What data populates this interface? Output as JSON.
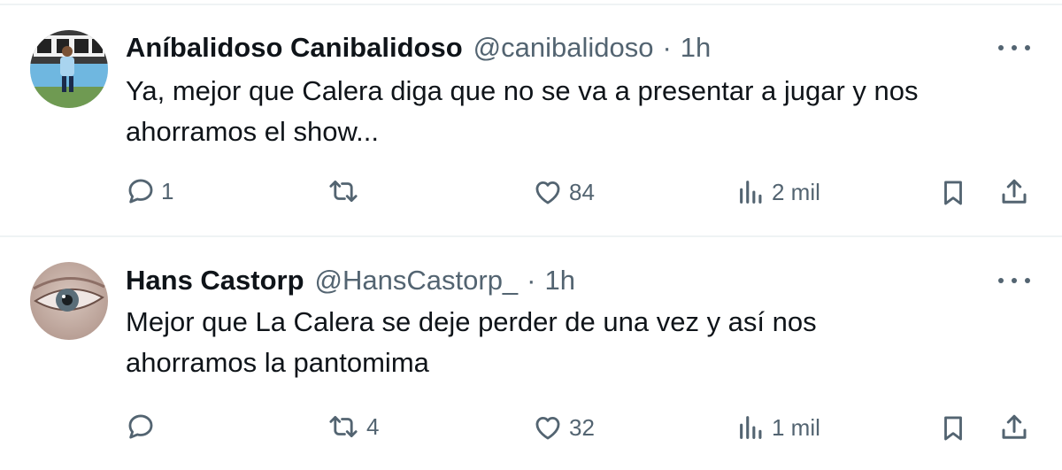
{
  "tweets": [
    {
      "display_name": "Aníbalidoso Canibalidoso",
      "handle": "@canibalidoso",
      "separator": "·",
      "time": "1h",
      "text": "Ya, mejor que Calera diga que no se va a presentar a jugar y nos ahorramos el show...",
      "replies": "1",
      "retweets": "",
      "likes": "84",
      "views": "2 mil"
    },
    {
      "display_name": "Hans Castorp",
      "handle": "@HansCastorp_",
      "separator": "·",
      "time": "1h",
      "text": "Mejor que La Calera se deje perder de una vez y así nos ahorramos la pantomima",
      "replies": "",
      "retweets": "4",
      "likes": "32",
      "views": "1 mil"
    }
  ],
  "colors": {
    "text": "#0f1419",
    "secondary": "#536471",
    "divider": "#eff3f4"
  },
  "icons": [
    "reply-icon",
    "retweet-icon",
    "like-icon",
    "views-icon",
    "bookmark-icon",
    "share-icon",
    "more-icon"
  ]
}
